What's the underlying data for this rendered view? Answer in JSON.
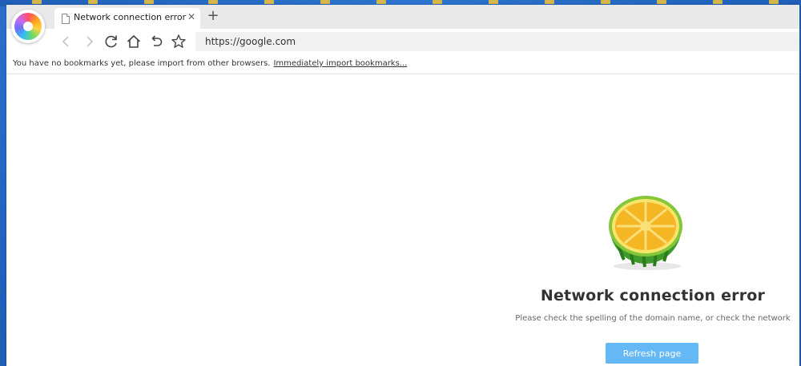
{
  "tab": {
    "title": "Network connection error",
    "close_icon": "close-icon",
    "page_icon": "page-icon"
  },
  "toolbar": {
    "back_icon": "chevron-left-icon",
    "forward_icon": "chevron-right-icon",
    "reload_icon": "reload-icon",
    "home_icon": "home-icon",
    "undo_icon": "undo-icon",
    "bookmark_icon": "star-icon",
    "new_tab_label": "+"
  },
  "address": {
    "url": "https://google.com"
  },
  "bookmarks": {
    "message": "You have no bookmarks yet, please import from other browsers.",
    "import_link": "Immediately import bookmarks..."
  },
  "error": {
    "illustration": "watermelon-lemon-icon",
    "title": "Network connection error",
    "description": "Please check the spelling of the domain name, or check the network",
    "refresh_label": "Refresh page"
  },
  "colors": {
    "accent": "#64b8f5",
    "tabstrip": "#e9e9e9",
    "desktop": "#2a6cc4"
  }
}
